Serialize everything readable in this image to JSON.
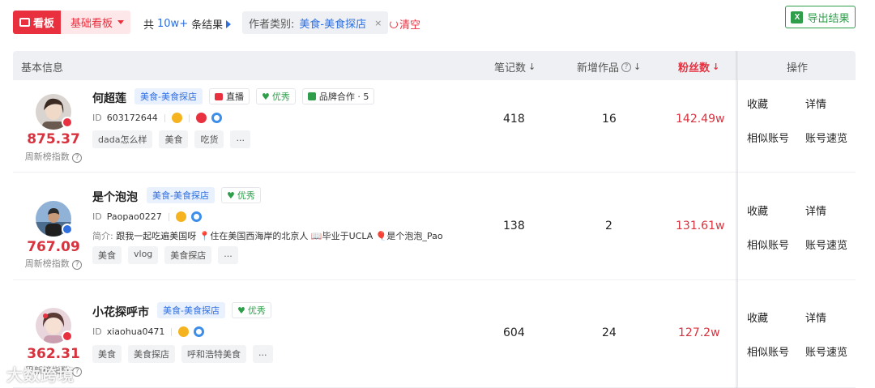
{
  "toolbar": {
    "kanban_label": "看板",
    "board_select": "基础看板",
    "result_prefix": "共",
    "result_count": "10w+",
    "result_suffix": "条结果",
    "filter_label": "作者类别:",
    "filter_value": "美食-美食探店",
    "filter_close": "×",
    "clear_label": "清空",
    "export_label": "导出结果"
  },
  "table": {
    "headers": {
      "basic": "基本信息",
      "notes": "笔记数",
      "new_works": "新增作品",
      "fans": "粉丝数",
      "ops": "操作"
    },
    "rows": [
      {
        "name": "何超莲",
        "category": "美食-美食探店",
        "tags": [
          "直播",
          "优秀",
          "品牌合作 · 5"
        ],
        "id_label": "ID",
        "id": "603172644",
        "intro_prefix": "",
        "intro": "",
        "topic_tags": [
          "dada怎么样",
          "美食",
          "吃货",
          "..."
        ],
        "score": "875.37",
        "score_label": "周新榜指数",
        "notes": "418",
        "new_works": "16",
        "fans": "142.49w",
        "ops": [
          "收藏",
          "详情",
          "相似账号",
          "账号速览"
        ]
      },
      {
        "name": "是个泡泡",
        "category": "美食-美食探店",
        "tags": [
          "优秀"
        ],
        "id_label": "ID",
        "id": "Paopao0227",
        "intro_prefix": "简介:",
        "intro": "跟我一起吃遍美国呀 📍住在美国西海岸的北京人 📖毕业于UCLA 🎈是个泡泡_Pao",
        "topic_tags": [
          "美食",
          "vlog",
          "美食探店",
          "..."
        ],
        "score": "767.09",
        "score_label": "周新榜指数",
        "notes": "138",
        "new_works": "2",
        "fans": "131.61w",
        "ops": [
          "收藏",
          "详情",
          "相似账号",
          "账号速览"
        ]
      },
      {
        "name": "小花探呼市",
        "category": "美食-美食探店",
        "tags": [
          "优秀"
        ],
        "id_label": "ID",
        "id": "xiaohua0471",
        "intro_prefix": "",
        "intro": "",
        "topic_tags": [
          "美食",
          "美食探店",
          "呼和浩特美食",
          "..."
        ],
        "score": "362.31",
        "score_label": "周新榜指数",
        "notes": "604",
        "new_works": "24",
        "fans": "127.2w",
        "ops": [
          "收藏",
          "详情",
          "相似账号",
          "账号速览"
        ]
      }
    ]
  },
  "watermark": "大数跨境",
  "colors": {
    "accent_red": "#e8303f",
    "link_blue": "#2f6fe0",
    "excel_green": "#2e9e4a"
  }
}
